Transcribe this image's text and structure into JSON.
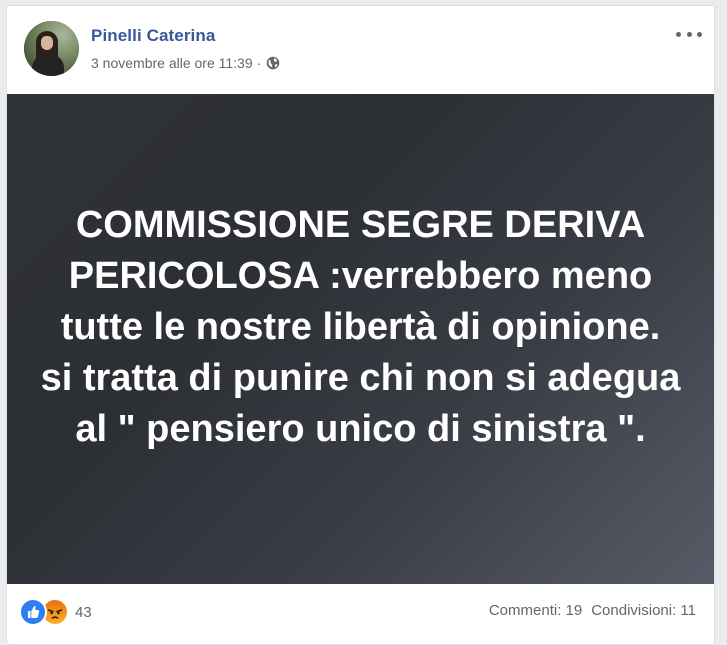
{
  "post": {
    "author": "Pinelli Caterina",
    "timestamp": "3 novembre alle ore 11:39",
    "separator": "·",
    "privacy_icon": "globe-icon",
    "menu_icon": "more-options-icon",
    "image_text": "COMMISSIONE SEGRE DERIVA PERICOLOSA :verrebbero meno tutte le nostre libertà di opinione. si tratta di punire chi non si adegua al \" pensiero unico di sinistra \"."
  },
  "footer": {
    "reaction_icons": [
      "like-icon",
      "angry-icon"
    ],
    "reaction_count": "43",
    "comments": "Commenti: 19",
    "shares": "Condivisioni: 11"
  },
  "colors": {
    "author_link": "#385898",
    "meta_text": "#616770",
    "like_blue": "#2f7ff0",
    "angry_orange": "#e9710f"
  }
}
